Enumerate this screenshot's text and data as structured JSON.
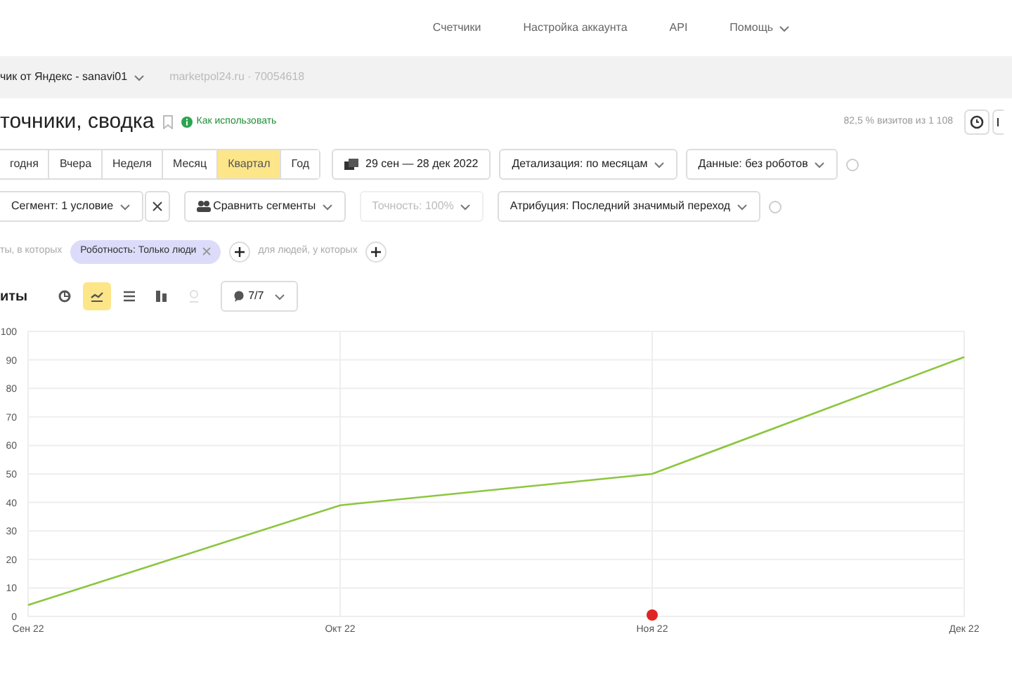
{
  "top_nav": [
    {
      "label": "Счетчики",
      "dropdown": false
    },
    {
      "label": "Настройка аккаунта",
      "dropdown": false
    },
    {
      "label": "API",
      "dropdown": false
    },
    {
      "label": "Помощь",
      "dropdown": true
    }
  ],
  "counter_bar": {
    "counter": "чик от Яндекс - sanavi01",
    "site": "marketpol24.ru · 70054618"
  },
  "report": {
    "title": "точники, сводка",
    "how_to": "Как использовать",
    "sampling": "82,5 % визитов из 1 108"
  },
  "periods": [
    {
      "label": "годня",
      "selected": false
    },
    {
      "label": "Вчера",
      "selected": false
    },
    {
      "label": "Неделя",
      "selected": false
    },
    {
      "label": "Месяц",
      "selected": false
    },
    {
      "label": "Квартал",
      "selected": true
    },
    {
      "label": "Год",
      "selected": false
    }
  ],
  "date_range": "29 сен — 28 дек 2022",
  "detail": "Детализация: по месяцам",
  "data_filter": "Данные: без роботов",
  "segment": "Сегмент: 1 условие",
  "compare": "Сравнить сегменты",
  "accuracy": {
    "label": "Точность: 100%",
    "disabled": true
  },
  "attribution": "Атрибуция: Последний значимый переход",
  "conditions": {
    "prefix": "ты, в которых",
    "chip": "Роботность: Только люди",
    "people_label": "для людей, у которых"
  },
  "chart_section": {
    "title": "иты",
    "chart_types": [
      {
        "kind": "pie",
        "selected": false,
        "disabled": false
      },
      {
        "kind": "line",
        "selected": true,
        "disabled": false
      },
      {
        "kind": "area",
        "selected": false,
        "disabled": false
      },
      {
        "kind": "bar",
        "selected": false,
        "disabled": false
      },
      {
        "kind": "map",
        "selected": false,
        "disabled": true
      }
    ],
    "notes": "7/7"
  },
  "chart_data": {
    "type": "line",
    "categories": [
      "Сен 22",
      "Окт 22",
      "Ноя 22",
      "Дек 22"
    ],
    "series": [
      {
        "color": "#8cc63f",
        "values": [
          4,
          39,
          50,
          91
        ]
      }
    ],
    "grid": true,
    "ylim": [
      0,
      100
    ],
    "yticks": [
      0,
      10,
      20,
      30,
      40,
      50,
      60,
      70,
      80,
      90,
      100
    ]
  }
}
